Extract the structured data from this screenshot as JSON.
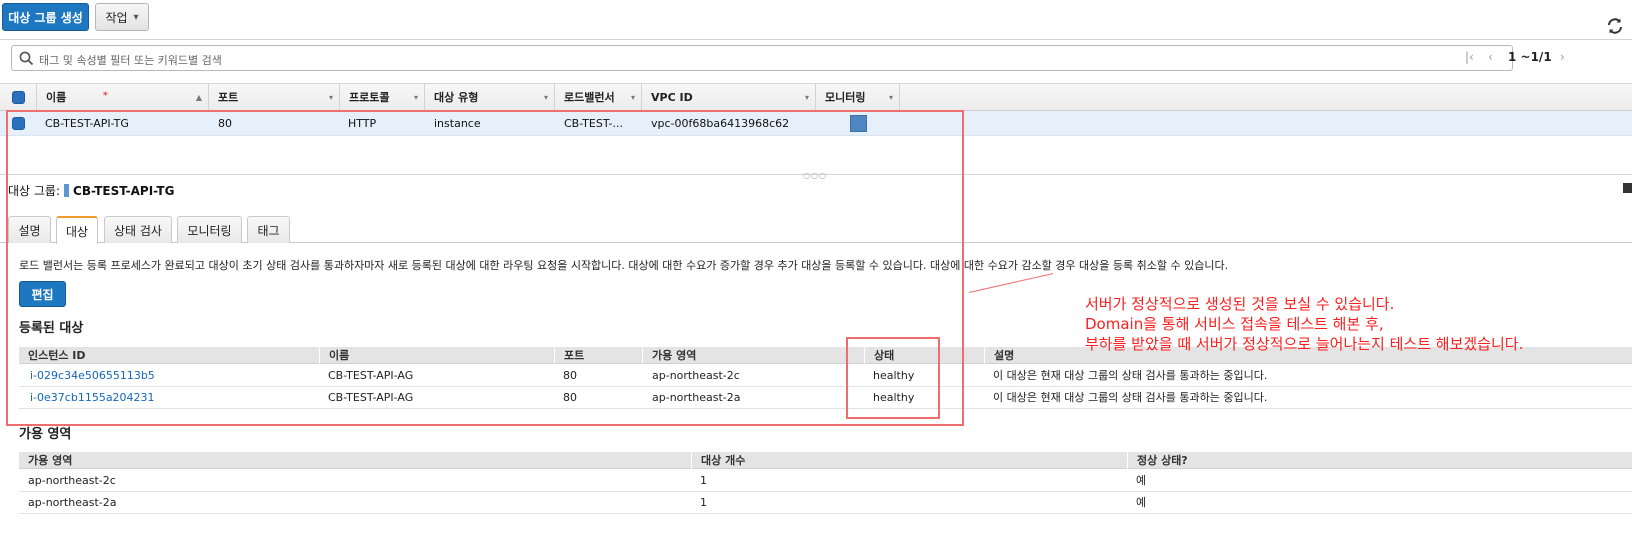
{
  "toolbar": {
    "create_label": "대상 그룹 생성",
    "actions_label": "작업",
    "actions_caret": "▾"
  },
  "search": {
    "placeholder": "태그 및 속성별 필터 또는 키워드별 검색"
  },
  "pagination": {
    "first": "|‹",
    "prev": "‹",
    "range": "1 ~1/1",
    "next": "›"
  },
  "grid": {
    "columns": [
      {
        "label": "이름",
        "caret": "▲"
      },
      {
        "label": "포트",
        "caret": "▾"
      },
      {
        "label": "프로토콜",
        "caret": "▾"
      },
      {
        "label": "대상 유형",
        "caret": "▾"
      },
      {
        "label": "로드밸런서",
        "caret": "▾"
      },
      {
        "label": "VPC ID",
        "caret": "▾"
      },
      {
        "label": "모니터링",
        "caret": "▾"
      }
    ],
    "row": {
      "name": "CB-TEST-API-TG",
      "port": "80",
      "protocol": "HTTP",
      "target_type": "instance",
      "load_balancer": "CB-TEST-...",
      "vpc_id": "vpc-00f68ba6413968c62"
    }
  },
  "detail": {
    "label": "대상 그룹:",
    "name": "CB-TEST-API-TG",
    "tabs": [
      "설명",
      "대상",
      "상태 검사",
      "모니터링",
      "태그"
    ],
    "active_tab": "대상",
    "description": "로드 밸런서는 등록 프로세스가 완료되고 대상이 초기 상태 검사를 통과하자마자 새로 등록된 대상에 대한 라우팅 요청을 시작합니다. 대상에 대한 수요가 증가할 경우 추가 대상을 등록할 수 있습니다. 대상에 대한 수요가 감소할 경우 대상을 등록 취소할 수 있습니다.",
    "edit_label": "편집",
    "registered_heading": "등록된 대상",
    "registered_columns": [
      "인스턴스 ID",
      "이름",
      "포트",
      "가용 영역",
      "상태",
      "설명"
    ],
    "registered_rows": [
      {
        "instance_id": "i-029c34e50655113b5",
        "name": "CB-TEST-API-AG",
        "port": "80",
        "az": "ap-northeast-2c",
        "status": "healthy",
        "desc": "이 대상은 현재 대상 그룹의 상태 검사를 통과하는 중입니다."
      },
      {
        "instance_id": "i-0e37cb1155a204231",
        "name": "CB-TEST-API-AG",
        "port": "80",
        "az": "ap-northeast-2a",
        "status": "healthy",
        "desc": "이 대상은 현재 대상 그룹의 상태 검사를 통과하는 중입니다."
      }
    ],
    "az_heading": "가용 영역",
    "az_columns": [
      "가용 영역",
      "대상 개수",
      "정상 상태?"
    ],
    "az_rows": [
      {
        "az": "ap-northeast-2c",
        "count": "1",
        "healthy": "예"
      },
      {
        "az": "ap-northeast-2a",
        "count": "1",
        "healthy": "예"
      }
    ]
  },
  "annotation": {
    "lines": [
      "서버가 정상적으로 생성된 것을 보실 수 있습니다.",
      "Domain을 통해 서비스 접속을 테스트 해본 후,",
      "부하를 받았을 때 서버가 정상적으로 늘어나는지 테스트 해보겠습니다."
    ],
    "color": "#ff1e1e"
  },
  "colors": {
    "primary": "#1d78c1",
    "link": "#1466b8",
    "selected_row": "#e6f0fa",
    "active_tab_accent": "#f09b2d"
  }
}
